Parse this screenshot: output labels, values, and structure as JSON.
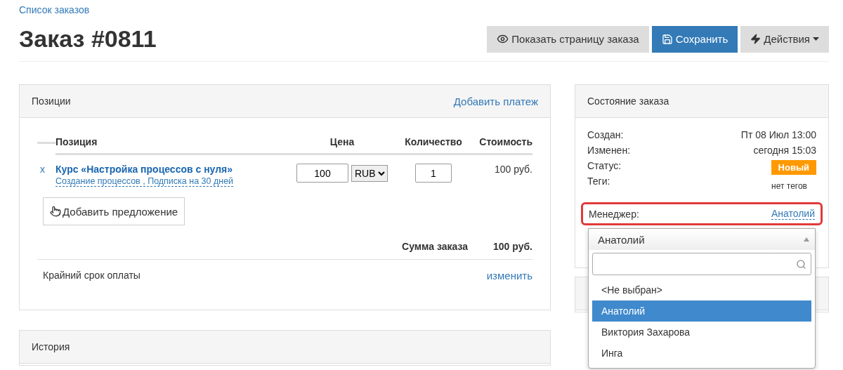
{
  "breadcrumb": "Список заказов",
  "title": "Заказ #0811",
  "actions": [
    {
      "kind": "view",
      "label": "Показать страницу заказа"
    },
    {
      "kind": "save",
      "label": "Сохранить"
    },
    {
      "kind": "menu",
      "label": "Действия"
    }
  ],
  "positions": {
    "title": "Позиции",
    "add_payment": "Добавить платеж",
    "columns": [
      "Позиция",
      "Цена",
      "Количество",
      "Стоимость"
    ],
    "rows": [
      {
        "remove": "x",
        "name": "Курс «Настройка процессов с нуля»",
        "details": "Создание процессов , Подписка на 30 дней",
        "price": "100",
        "currency": "RUB",
        "quantity": "1",
        "cost": "100 руб."
      }
    ],
    "add_offer": "Добавить предложение",
    "total_label": "Сумма заказа",
    "total_value": "100 руб.",
    "deadline_label": "Крайний срок оплаты",
    "deadline_link": "изменить"
  },
  "history": {
    "title": "История"
  },
  "status": {
    "title": "Состояние заказа",
    "fields": [
      {
        "kind": "text",
        "label": "Создан:",
        "value": "Пт 08 Июл 13:00"
      },
      {
        "kind": "text",
        "label": "Изменен:",
        "value": "сегодня 15:03"
      },
      {
        "kind": "badge",
        "label": "Статус:",
        "value": "Новый"
      },
      {
        "kind": "tags",
        "label": "Теги:",
        "value": "нет тегов"
      }
    ],
    "manager": {
      "label": "Менеджер:",
      "value": "Анатолий",
      "highlighted": true
    },
    "dropdown": {
      "current": "Анатолий",
      "options": [
        {
          "label": "<Не выбран>",
          "selected": false
        },
        {
          "label": "Анатолий",
          "selected": true
        },
        {
          "label": "Виктория Захарова",
          "selected": false
        },
        {
          "label": "Инга",
          "selected": false
        }
      ]
    }
  }
}
